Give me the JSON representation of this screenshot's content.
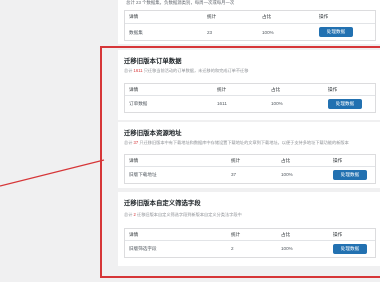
{
  "top": {
    "description": "总计 23 个数据集，负数据源类别，每周一次或每月一次",
    "headers": [
      "详情",
      "统计",
      "占比",
      "操作"
    ],
    "row": {
      "name": "数据集",
      "count": "23",
      "percent": "100%",
      "action": "处理数据"
    }
  },
  "sections": [
    {
      "title": "迁移旧版本订单数据",
      "description_prefix": "总计 ",
      "description_number": "1611",
      "description_suffix": " 只迁移当前活动的订单数据，未迁移的和完成订单不迁移",
      "headers": [
        "详情",
        "统计",
        "占比",
        "操作"
      ],
      "row": {
        "name": "订单数据",
        "count": "1611",
        "percent": "100%",
        "action": "处理数据"
      }
    },
    {
      "title": "迁移旧版本资源地址",
      "description_prefix": "总计 ",
      "description_number": "37",
      "description_suffix": " 只迁移旧版本中有下载地址和数据库中存储设置下载地址的文章到下载地址。以便于支持多地址下载功能的新版本",
      "headers": [
        "详情",
        "统计",
        "占比",
        "操作"
      ],
      "row": {
        "name": "旧版下载地址",
        "count": "37",
        "percent": "100%",
        "action": "处理数据"
      }
    },
    {
      "title": "迁移旧版本自定义筛选字段",
      "description_prefix": "总计 ",
      "description_number": "2",
      "description_suffix": " 迁移旧版本自定义筛选字段到新版本自定义分类法字段中",
      "headers": [
        "详情",
        "统计",
        "占比",
        "操作"
      ],
      "row": {
        "name": "旧版筛选字段",
        "count": "2",
        "percent": "100%",
        "action": "处理数据"
      }
    }
  ],
  "colors": {
    "accent": "#2271b1",
    "highlight": "#d63638"
  }
}
